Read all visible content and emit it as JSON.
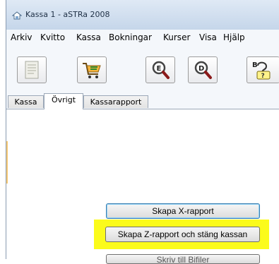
{
  "window": {
    "title": "Kassa 1 - aSTRa 2008",
    "icon": "app-icon"
  },
  "menu": {
    "items": [
      "Arkiv",
      "Kvitto",
      "Kassa",
      "Bokningar",
      "Kurser",
      "Visa",
      "Hjälp"
    ]
  },
  "toolbar": {
    "buttons": [
      {
        "icon": "document-icon"
      },
      {
        "icon": "shopping-cart-icon"
      },
      {
        "icon": "magnifier-e-icon"
      },
      {
        "icon": "magnifier-d-icon"
      },
      {
        "icon": "booking-question-icon"
      }
    ]
  },
  "tabs": {
    "items": [
      "Kassa",
      "Övrigt",
      "Kassarapport"
    ],
    "active": "Övrigt"
  },
  "actions": {
    "x_report": "Skapa X-rapport",
    "z_report": "Skapa Z-rapport och stäng kassan",
    "partial_button": "Skriv till Bifiler"
  },
  "colors": {
    "highlight": "#fbfb1b",
    "focus_border": "#3c7fb1"
  }
}
